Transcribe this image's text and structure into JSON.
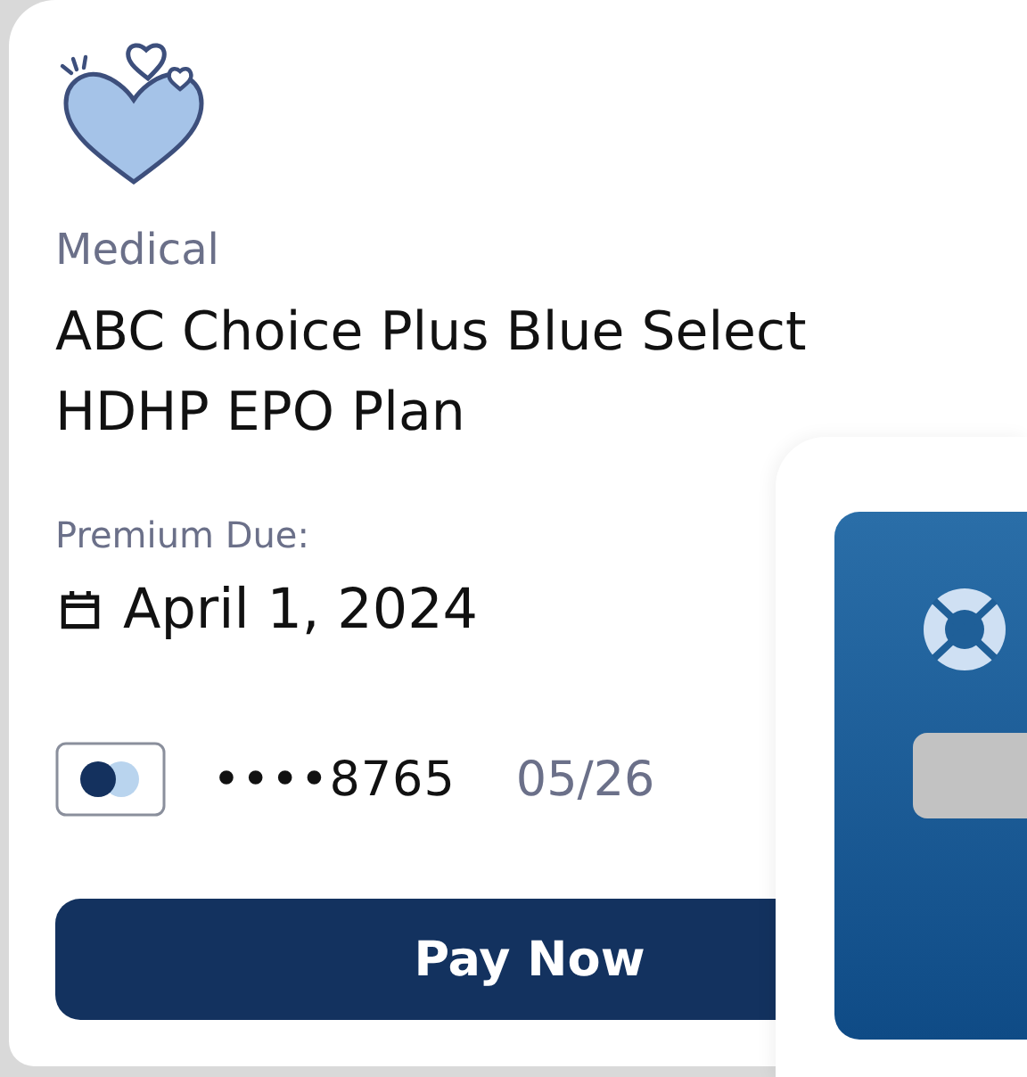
{
  "plan": {
    "category": "Medical",
    "name": "ABC Choice Plus Blue Select HDHP EPO Plan"
  },
  "premium": {
    "label": "Premium Due:",
    "date": "April 1, 2024"
  },
  "payment_method": {
    "number": "••••8765",
    "expiry": "05/26"
  },
  "button": "Pay Now"
}
